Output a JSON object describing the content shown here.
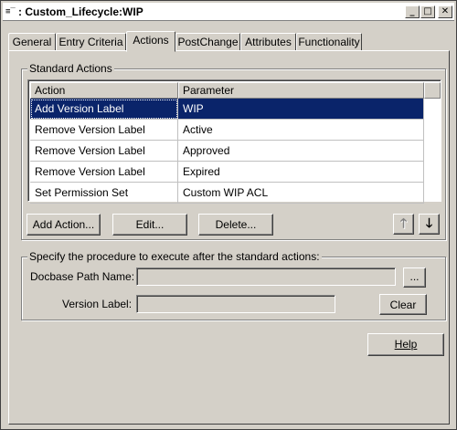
{
  "window": {
    "title": ": Custom_Lifecycle:WIP",
    "system_icon": "≡‾"
  },
  "titlebar_buttons": {
    "minimize_icon": "minimize-icon",
    "maximize_icon": "maximize-icon",
    "close_icon": "close-icon"
  },
  "tabs": [
    {
      "label": "General"
    },
    {
      "label": "Entry Criteria"
    },
    {
      "label": "Actions"
    },
    {
      "label": "PostChange"
    },
    {
      "label": "Attributes"
    },
    {
      "label": "Functionality"
    }
  ],
  "active_tab": "Actions",
  "standard_actions": {
    "legend": "Standard Actions",
    "columns": [
      "Action",
      "Parameter"
    ],
    "rows": [
      {
        "action": "Add Version Label",
        "parameter": "WIP",
        "selected": true
      },
      {
        "action": "Remove Version Label",
        "parameter": "Active",
        "selected": false
      },
      {
        "action": "Remove Version Label",
        "parameter": "Approved",
        "selected": false
      },
      {
        "action": "Remove Version Label",
        "parameter": "Expired",
        "selected": false
      },
      {
        "action": "Set Permission Set",
        "parameter": "Custom WIP ACL",
        "selected": false
      }
    ],
    "buttons": {
      "add": "Add Action...",
      "edit": "Edit...",
      "delete": "Delete..."
    },
    "move_up_icon": "arrow-up-icon",
    "move_down_icon": "arrow-down-icon",
    "move_up_glyph": "🡑",
    "move_down_glyph": "🡓"
  },
  "procedure": {
    "legend": "Specify the procedure to execute after the standard actions:",
    "docbase_path_label": "Docbase Path Name:",
    "docbase_path_value": "",
    "browse_label": "...",
    "version_label_label": "Version Label:",
    "version_label_value": "",
    "clear_label": "Clear"
  },
  "footer": {
    "help_label": "Help"
  }
}
